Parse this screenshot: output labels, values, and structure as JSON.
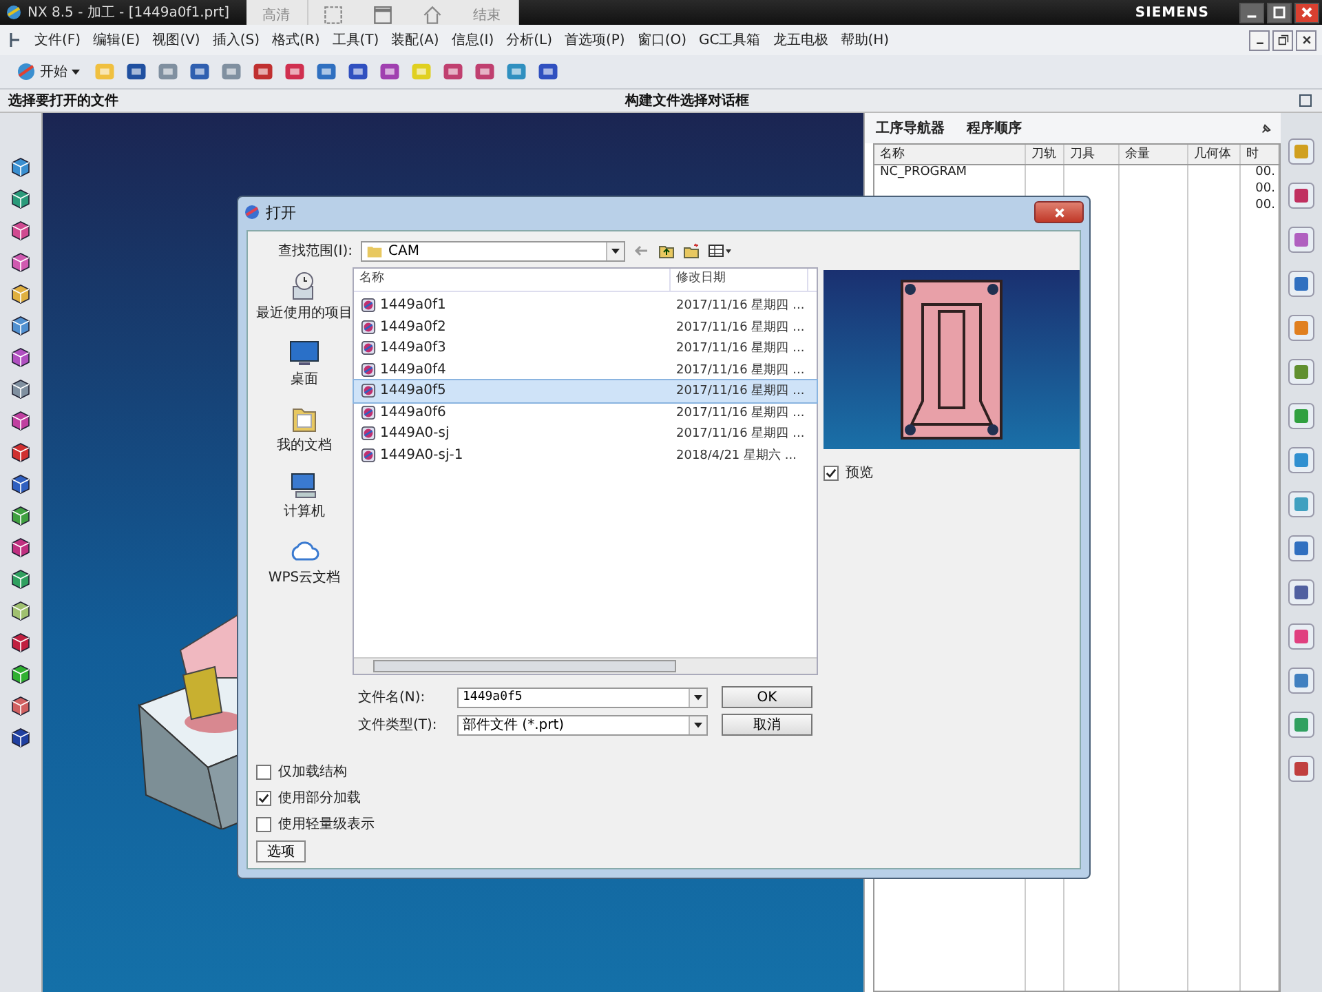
{
  "window": {
    "title": "NX 8.5 - 加工 - [1449a0f1.prt]",
    "brand": "SIEMENS"
  },
  "recorder_bar": {
    "quality": "高清",
    "end": "结束"
  },
  "menu": [
    "文件(F)",
    "编辑(E)",
    "视图(V)",
    "插入(S)",
    "格式(R)",
    "工具(T)",
    "装配(A)",
    "信息(I)",
    "分析(L)",
    "首选项(P)",
    "窗口(O)",
    "GC工具箱",
    "龙五电极",
    "帮助(H)"
  ],
  "toolbar": {
    "start": "开始"
  },
  "cue_line": {
    "prompt": "选择要打开的文件",
    "status": "构建文件选择对话框"
  },
  "navigator": {
    "title": "工序导航器",
    "view": "程序顺序",
    "columns": [
      "名称",
      "刀轨",
      "刀具",
      "余量",
      "几何体",
      "时"
    ],
    "rows": [
      {
        "name": "NC_PROGRAM",
        "time": "00."
      },
      {
        "time": "00."
      },
      {
        "time": "00."
      }
    ]
  },
  "dialog": {
    "title": "打开",
    "look_in_label": "查找范围(I):",
    "look_in": "CAM",
    "places": [
      {
        "kind": "recent",
        "label": "最近使用的项目"
      },
      {
        "kind": "desktop",
        "label": "桌面"
      },
      {
        "kind": "documents",
        "label": "我的文档"
      },
      {
        "kind": "computer",
        "label": "计算机"
      },
      {
        "kind": "cloud",
        "label": "WPS云文档"
      }
    ],
    "columns": [
      "名称",
      "修改日期"
    ],
    "files": [
      {
        "name": "1449a0f1",
        "date": "2017/11/16 星期四 ...",
        "selected": false
      },
      {
        "name": "1449a0f2",
        "date": "2017/11/16 星期四 ...",
        "selected": false
      },
      {
        "name": "1449a0f3",
        "date": "2017/11/16 星期四 ...",
        "selected": false
      },
      {
        "name": "1449a0f4",
        "date": "2017/11/16 星期四 ...",
        "selected": false
      },
      {
        "name": "1449a0f5",
        "date": "2017/11/16 星期四 ...",
        "selected": true
      },
      {
        "name": "1449a0f6",
        "date": "2017/11/16 星期四 ...",
        "selected": false
      },
      {
        "name": "1449A0-sj",
        "date": "2017/11/16 星期四 ...",
        "selected": false
      },
      {
        "name": "1449A0-sj-1",
        "date": "2018/4/21 星期六 ...",
        "selected": false
      }
    ],
    "preview_label": "预览",
    "preview_checked": true,
    "file_name_label": "文件名(N):",
    "file_name": "1449a0f5",
    "file_type_label": "文件类型(T):",
    "file_type": "部件文件 (*.prt)",
    "ok": "OK",
    "cancel": "取消",
    "options": [
      {
        "label": "仅加载结构",
        "checked": false
      },
      {
        "label": "使用部分加载",
        "checked": true
      },
      {
        "label": "使用轻量级表示",
        "checked": false
      }
    ],
    "options_button": "选项"
  }
}
